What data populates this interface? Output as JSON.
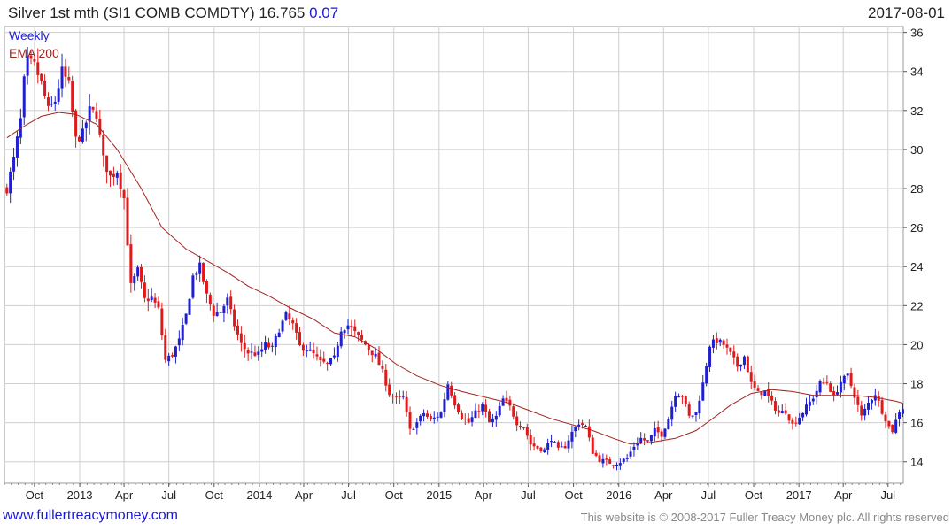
{
  "header": {
    "title": "Silver 1st mth (SI1 COMB COMDTY) 16.765",
    "change": "0.07",
    "date": "2017-08-01"
  },
  "footer": {
    "url": "www.fullertreacymoney.com",
    "copyright": "This website is © 2008-2017 Fuller Treacy Money plc. All rights reserved"
  },
  "colors": {
    "up": "#1f1fcf",
    "down": "#e01a1a",
    "ema": "#a3231f",
    "grid": "#cfcfcf",
    "legend_weekly": "#1f1fcf",
    "legend_ema": "#a3231f"
  },
  "chart_data": {
    "type": "candlestick",
    "grid": true,
    "legend": {
      "position": "top-left",
      "entries": [
        "Weekly",
        "EMA 200"
      ]
    },
    "x_ticks": [
      {
        "label": "Oct",
        "x": "2012-10-01"
      },
      {
        "label": "2013",
        "x": "2013-01-01"
      },
      {
        "label": "Apr",
        "x": "2013-04-01"
      },
      {
        "label": "Jul",
        "x": "2013-07-01"
      },
      {
        "label": "Oct",
        "x": "2013-10-01"
      },
      {
        "label": "2014",
        "x": "2014-01-01"
      },
      {
        "label": "Apr",
        "x": "2014-04-01"
      },
      {
        "label": "Jul",
        "x": "2014-07-01"
      },
      {
        "label": "Oct",
        "x": "2014-10-01"
      },
      {
        "label": "2015",
        "x": "2015-01-01"
      },
      {
        "label": "Apr",
        "x": "2015-04-01"
      },
      {
        "label": "Jul",
        "x": "2015-07-01"
      },
      {
        "label": "Oct",
        "x": "2015-10-01"
      },
      {
        "label": "2016",
        "x": "2016-01-01"
      },
      {
        "label": "Apr",
        "x": "2016-04-01"
      },
      {
        "label": "Jul",
        "x": "2016-07-01"
      },
      {
        "label": "Oct",
        "x": "2016-10-01"
      },
      {
        "label": "2017",
        "x": "2017-01-01"
      },
      {
        "label": "Apr",
        "x": "2017-04-01"
      },
      {
        "label": "Jul",
        "x": "2017-07-01"
      }
    ],
    "x_range": [
      "2012-08-01",
      "2017-08-01"
    ],
    "y_ticks": [
      14,
      16,
      18,
      20,
      22,
      24,
      26,
      28,
      30,
      32,
      34,
      36
    ],
    "y_range": [
      12.9,
      36.3
    ],
    "close_anchors": [
      [
        "2012-08-06",
        28.0
      ],
      [
        "2012-08-20",
        29.5
      ],
      [
        "2012-09-03",
        31.5
      ],
      [
        "2012-09-10",
        33.5
      ],
      [
        "2012-09-17",
        34.5
      ],
      [
        "2012-10-01",
        34.3
      ],
      [
        "2012-10-15",
        33.4
      ],
      [
        "2012-10-29",
        32.0
      ],
      [
        "2012-11-12",
        32.5
      ],
      [
        "2012-11-26",
        34.0
      ],
      [
        "2012-12-10",
        33.3
      ],
      [
        "2012-12-24",
        30.5
      ],
      [
        "2013-01-07",
        30.8
      ],
      [
        "2013-01-21",
        32.0
      ],
      [
        "2013-02-04",
        31.8
      ],
      [
        "2013-02-18",
        29.5
      ],
      [
        "2013-03-04",
        28.6
      ],
      [
        "2013-03-18",
        28.9
      ],
      [
        "2013-04-01",
        27.5
      ],
      [
        "2013-04-15",
        23.0
      ],
      [
        "2013-04-29",
        23.8
      ],
      [
        "2013-05-13",
        22.3
      ],
      [
        "2013-05-27",
        22.4
      ],
      [
        "2013-06-10",
        21.8
      ],
      [
        "2013-06-24",
        19.2
      ],
      [
        "2013-07-08",
        19.5
      ],
      [
        "2013-07-22",
        20.2
      ],
      [
        "2013-08-05",
        21.5
      ],
      [
        "2013-08-19",
        23.5
      ],
      [
        "2013-09-02",
        24.0
      ],
      [
        "2013-09-16",
        22.5
      ],
      [
        "2013-09-30",
        21.6
      ],
      [
        "2013-10-14",
        21.7
      ],
      [
        "2013-10-28",
        22.3
      ],
      [
        "2013-11-11",
        21.0
      ],
      [
        "2013-11-25",
        20.0
      ],
      [
        "2013-12-09",
        19.6
      ],
      [
        "2013-12-30",
        19.5
      ],
      [
        "2014-01-13",
        20.0
      ],
      [
        "2014-01-27",
        19.8
      ],
      [
        "2014-02-10",
        20.8
      ],
      [
        "2014-02-24",
        21.5
      ],
      [
        "2014-03-10",
        21.0
      ],
      [
        "2014-03-24",
        19.9
      ],
      [
        "2014-04-07",
        19.8
      ],
      [
        "2014-04-21",
        19.5
      ],
      [
        "2014-05-05",
        19.1
      ],
      [
        "2014-05-19",
        19.0
      ],
      [
        "2014-06-02",
        19.3
      ],
      [
        "2014-06-16",
        20.8
      ],
      [
        "2014-06-30",
        21.0
      ],
      [
        "2014-07-14",
        20.6
      ],
      [
        "2014-07-28",
        20.2
      ],
      [
        "2014-08-11",
        19.8
      ],
      [
        "2014-08-25",
        19.4
      ],
      [
        "2014-09-08",
        18.6
      ],
      [
        "2014-09-22",
        17.5
      ],
      [
        "2014-10-06",
        17.2
      ],
      [
        "2014-10-20",
        17.3
      ],
      [
        "2014-11-03",
        15.6
      ],
      [
        "2014-11-17",
        16.0
      ],
      [
        "2014-12-01",
        16.5
      ],
      [
        "2014-12-15",
        16.1
      ],
      [
        "2015-01-05",
        16.5
      ],
      [
        "2015-01-19",
        18.0
      ],
      [
        "2015-02-02",
        17.0
      ],
      [
        "2015-02-16",
        16.3
      ],
      [
        "2015-03-02",
        16.0
      ],
      [
        "2015-03-16",
        16.5
      ],
      [
        "2015-03-30",
        16.9
      ],
      [
        "2015-04-13",
        16.0
      ],
      [
        "2015-04-27",
        16.3
      ],
      [
        "2015-05-11",
        17.2
      ],
      [
        "2015-05-25",
        16.8
      ],
      [
        "2015-06-08",
        16.0
      ],
      [
        "2015-06-22",
        15.8
      ],
      [
        "2015-07-06",
        14.9
      ],
      [
        "2015-07-20",
        14.7
      ],
      [
        "2015-08-03",
        14.6
      ],
      [
        "2015-08-17",
        15.2
      ],
      [
        "2015-08-31",
        14.6
      ],
      [
        "2015-09-14",
        14.8
      ],
      [
        "2015-09-28",
        15.5
      ],
      [
        "2015-10-12",
        16.0
      ],
      [
        "2015-10-26",
        15.8
      ],
      [
        "2015-11-09",
        14.5
      ],
      [
        "2015-11-23",
        14.1
      ],
      [
        "2015-12-07",
        14.0
      ],
      [
        "2015-12-21",
        13.9
      ],
      [
        "2016-01-04",
        14.0
      ],
      [
        "2016-01-18",
        14.2
      ],
      [
        "2016-02-01",
        14.8
      ],
      [
        "2016-02-15",
        15.2
      ],
      [
        "2016-02-29",
        15.0
      ],
      [
        "2016-03-14",
        15.6
      ],
      [
        "2016-03-28",
        15.4
      ],
      [
        "2016-04-11",
        16.2
      ],
      [
        "2016-04-25",
        17.5
      ],
      [
        "2016-05-09",
        17.4
      ],
      [
        "2016-05-23",
        16.3
      ],
      [
        "2016-06-06",
        16.5
      ],
      [
        "2016-06-20",
        18.0
      ],
      [
        "2016-07-04",
        20.0
      ],
      [
        "2016-07-18",
        20.2
      ],
      [
        "2016-08-01",
        20.0
      ],
      [
        "2016-08-15",
        19.5
      ],
      [
        "2016-08-29",
        18.9
      ],
      [
        "2016-09-12",
        19.4
      ],
      [
        "2016-09-26",
        18.0
      ],
      [
        "2016-10-10",
        17.5
      ],
      [
        "2016-10-24",
        17.6
      ],
      [
        "2016-11-07",
        17.0
      ],
      [
        "2016-11-21",
        16.5
      ],
      [
        "2016-12-05",
        16.6
      ],
      [
        "2016-12-19",
        15.9
      ],
      [
        "2017-01-02",
        16.3
      ],
      [
        "2017-01-16",
        16.8
      ],
      [
        "2017-01-30",
        17.3
      ],
      [
        "2017-02-13",
        18.0
      ],
      [
        "2017-02-27",
        18.1
      ],
      [
        "2017-03-13",
        17.3
      ],
      [
        "2017-03-27",
        18.1
      ],
      [
        "2017-04-10",
        18.4
      ],
      [
        "2017-04-24",
        17.4
      ],
      [
        "2017-05-08",
        16.3
      ],
      [
        "2017-05-22",
        17.0
      ],
      [
        "2017-06-05",
        17.5
      ],
      [
        "2017-06-19",
        16.6
      ],
      [
        "2017-07-03",
        15.8
      ],
      [
        "2017-07-10",
        15.6
      ],
      [
        "2017-07-24",
        16.6
      ],
      [
        "2017-07-31",
        16.765
      ]
    ],
    "ema_anchors": [
      [
        "2012-08-06",
        30.6
      ],
      [
        "2012-09-10",
        31.2
      ],
      [
        "2012-10-15",
        31.7
      ],
      [
        "2012-11-19",
        31.9
      ],
      [
        "2012-12-24",
        31.8
      ],
      [
        "2013-02-04",
        31.3
      ],
      [
        "2013-03-18",
        30.0
      ],
      [
        "2013-05-06",
        28.0
      ],
      [
        "2013-06-17",
        26.0
      ],
      [
        "2013-08-05",
        24.9
      ],
      [
        "2013-09-16",
        24.3
      ],
      [
        "2013-10-28",
        23.7
      ],
      [
        "2013-12-09",
        23.0
      ],
      [
        "2014-01-20",
        22.5
      ],
      [
        "2014-03-03",
        21.9
      ],
      [
        "2014-04-21",
        21.3
      ],
      [
        "2014-06-02",
        20.6
      ],
      [
        "2014-07-14",
        20.4
      ],
      [
        "2014-08-25",
        19.8
      ],
      [
        "2014-10-06",
        19.0
      ],
      [
        "2014-11-17",
        18.4
      ],
      [
        "2015-01-05",
        17.9
      ],
      [
        "2015-02-16",
        17.6
      ],
      [
        "2015-04-06",
        17.3
      ],
      [
        "2015-05-25",
        17.0
      ],
      [
        "2015-07-06",
        16.6
      ],
      [
        "2015-08-17",
        16.2
      ],
      [
        "2015-09-28",
        15.9
      ],
      [
        "2015-11-09",
        15.6
      ],
      [
        "2015-12-21",
        15.2
      ],
      [
        "2016-01-25",
        14.9
      ],
      [
        "2016-03-07",
        15.0
      ],
      [
        "2016-04-25",
        15.2
      ],
      [
        "2016-06-06",
        15.6
      ],
      [
        "2016-07-04",
        16.1
      ],
      [
        "2016-08-15",
        16.9
      ],
      [
        "2016-09-26",
        17.5
      ],
      [
        "2016-11-07",
        17.7
      ],
      [
        "2016-12-19",
        17.6
      ],
      [
        "2017-01-30",
        17.4
      ],
      [
        "2017-03-13",
        17.4
      ],
      [
        "2017-04-24",
        17.4
      ],
      [
        "2017-06-05",
        17.3
      ],
      [
        "2017-07-17",
        17.1
      ],
      [
        "2017-07-31",
        17.0
      ]
    ]
  }
}
